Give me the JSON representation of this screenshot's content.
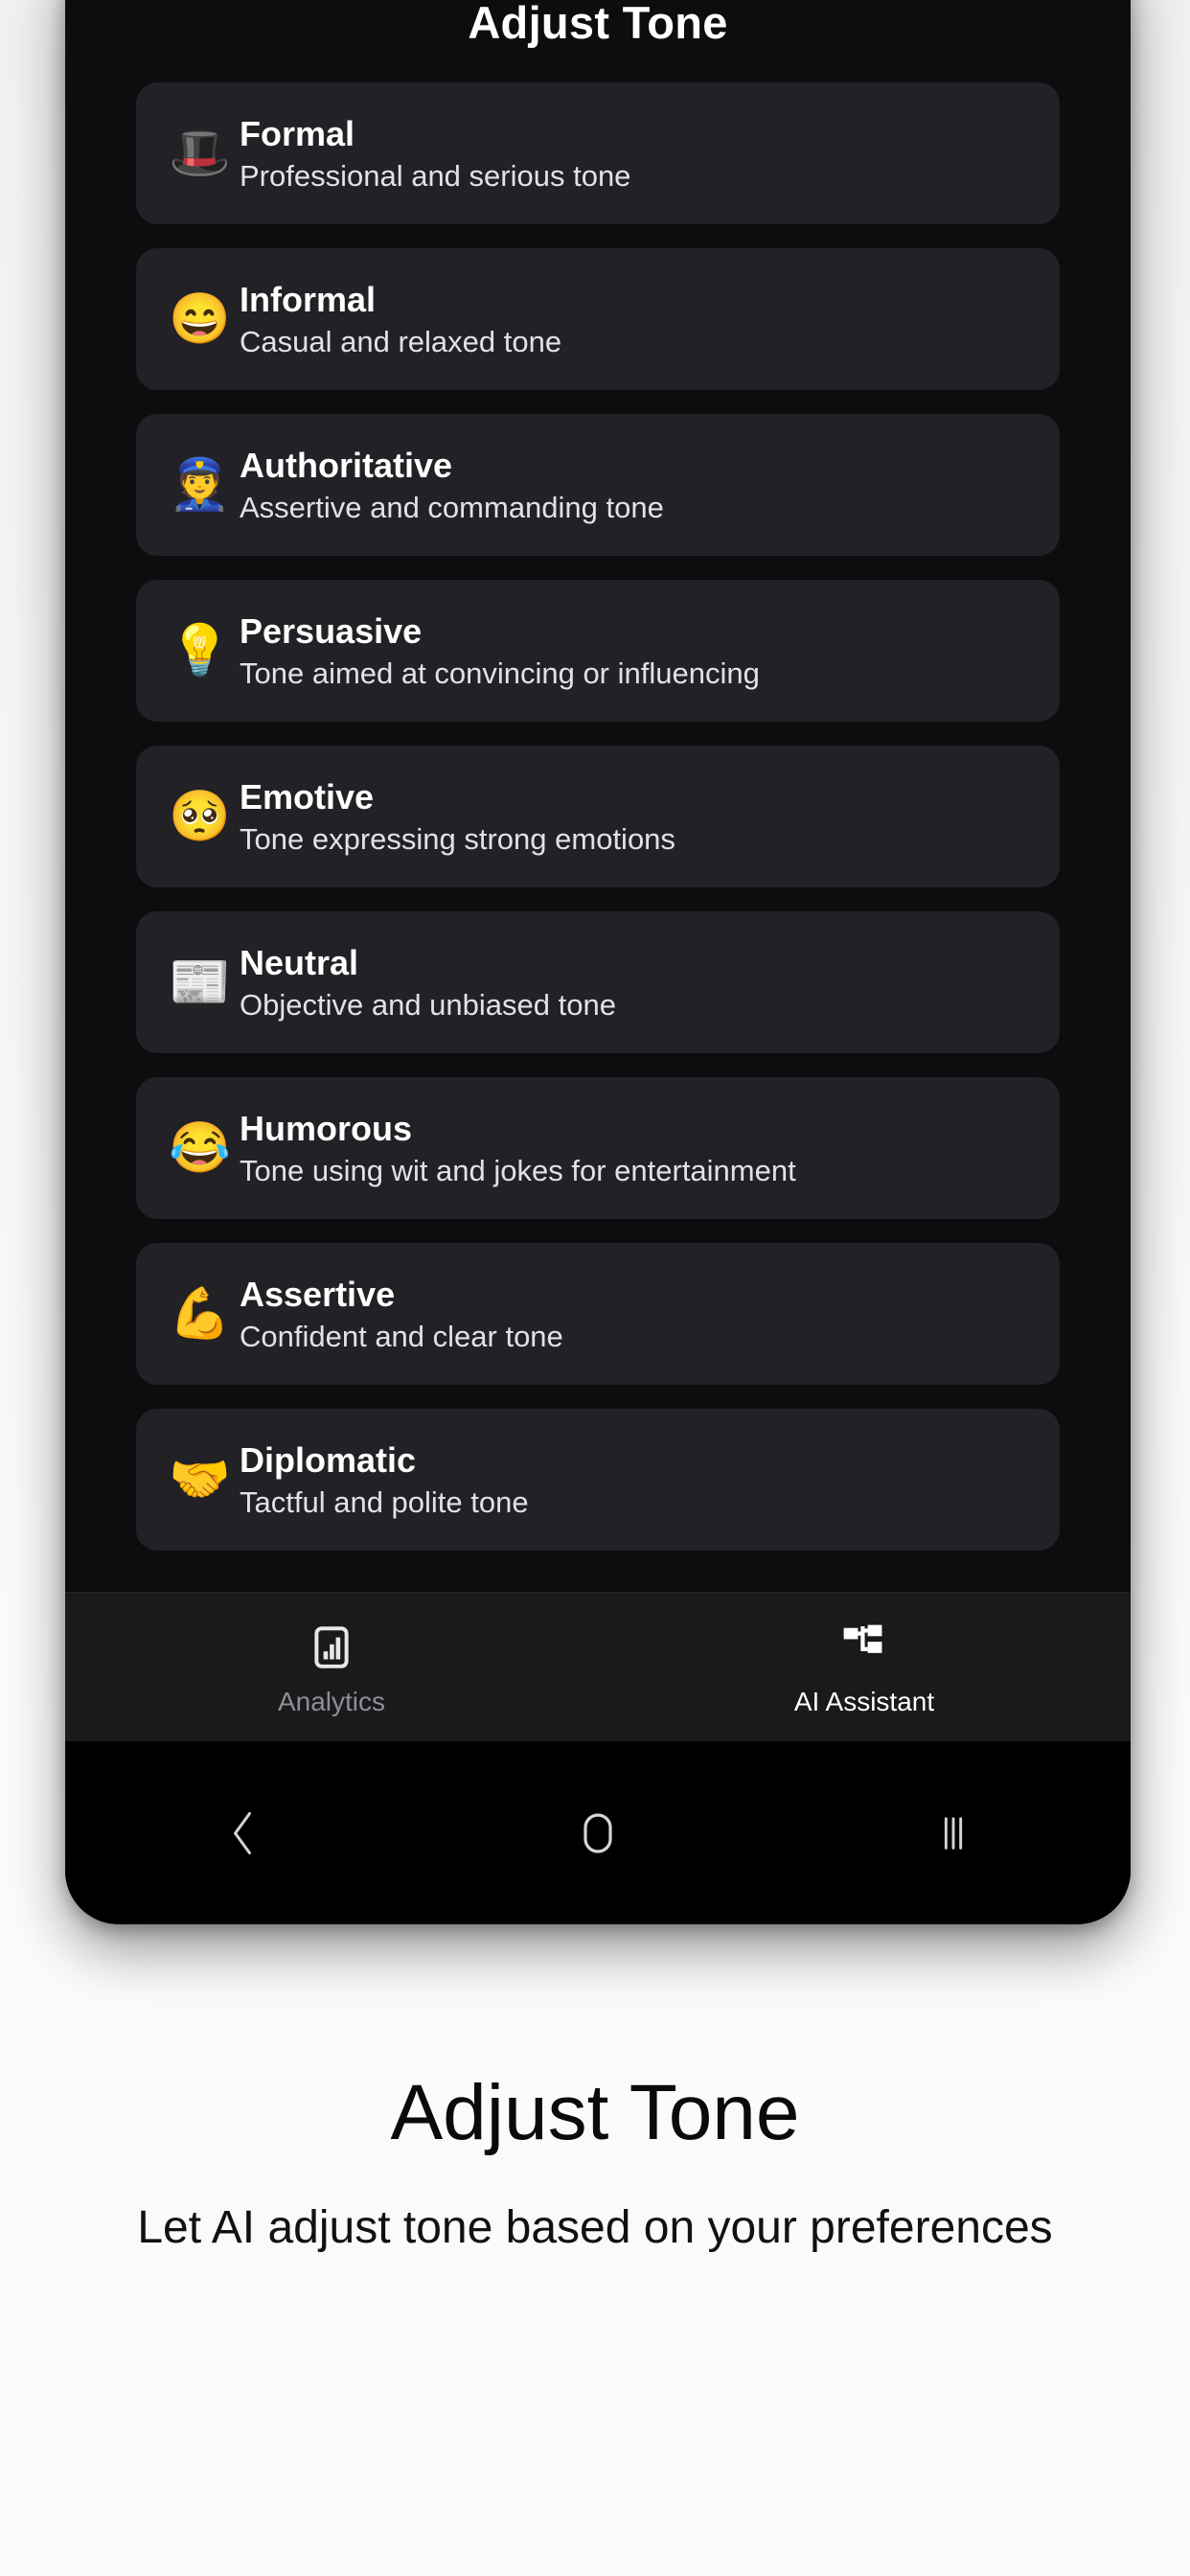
{
  "screen": {
    "header": {
      "title": "Adjust Tone"
    },
    "tones": [
      {
        "emoji": "🎩",
        "icon_name": "top-hat-icon",
        "name": "Formal",
        "desc": "Professional and serious tone"
      },
      {
        "emoji": "😄",
        "icon_name": "grinning-face-icon",
        "name": "Informal",
        "desc": "Casual and relaxed tone"
      },
      {
        "emoji": "👮",
        "icon_name": "police-officer-icon",
        "name": "Authoritative",
        "desc": "Assertive and commanding tone"
      },
      {
        "emoji": "💡",
        "icon_name": "light-bulb-icon",
        "name": "Persuasive",
        "desc": "Tone aimed at convincing or influencing"
      },
      {
        "emoji": "🥺",
        "icon_name": "pleading-face-icon",
        "name": "Emotive",
        "desc": "Tone expressing strong emotions"
      },
      {
        "emoji": "📰",
        "icon_name": "newspaper-icon",
        "name": "Neutral",
        "desc": "Objective and unbiased tone"
      },
      {
        "emoji": "😂",
        "icon_name": "tears-of-joy-icon",
        "name": "Humorous",
        "desc": "Tone using wit and jokes for entertainment"
      },
      {
        "emoji": "💪",
        "icon_name": "flexed-biceps-icon",
        "name": "Assertive",
        "desc": "Confident and clear tone"
      },
      {
        "emoji": "🤝",
        "icon_name": "handshake-icon",
        "name": "Diplomatic",
        "desc": "Tactful and polite tone"
      }
    ],
    "bottom_nav": {
      "items": [
        {
          "label": "Analytics",
          "icon_name": "bar-chart-phone-icon",
          "active": false
        },
        {
          "label": "AI Assistant",
          "icon_name": "node-network-icon",
          "active": true
        }
      ]
    },
    "system_nav": {
      "back": "back-chevron-icon",
      "home": "home-pill-icon",
      "recents": "recents-bars-icon"
    }
  },
  "caption": {
    "title": "Adjust Tone",
    "subtitle": "Let AI adjust tone based on your preferences"
  },
  "colors": {
    "page_background": "#f7f6f4",
    "screen_background": "#0d0d0f",
    "card_background": "#212126",
    "nav_background": "#1a1a1d",
    "accent_text": "#ffffff",
    "muted_text": "#8e8e93"
  }
}
